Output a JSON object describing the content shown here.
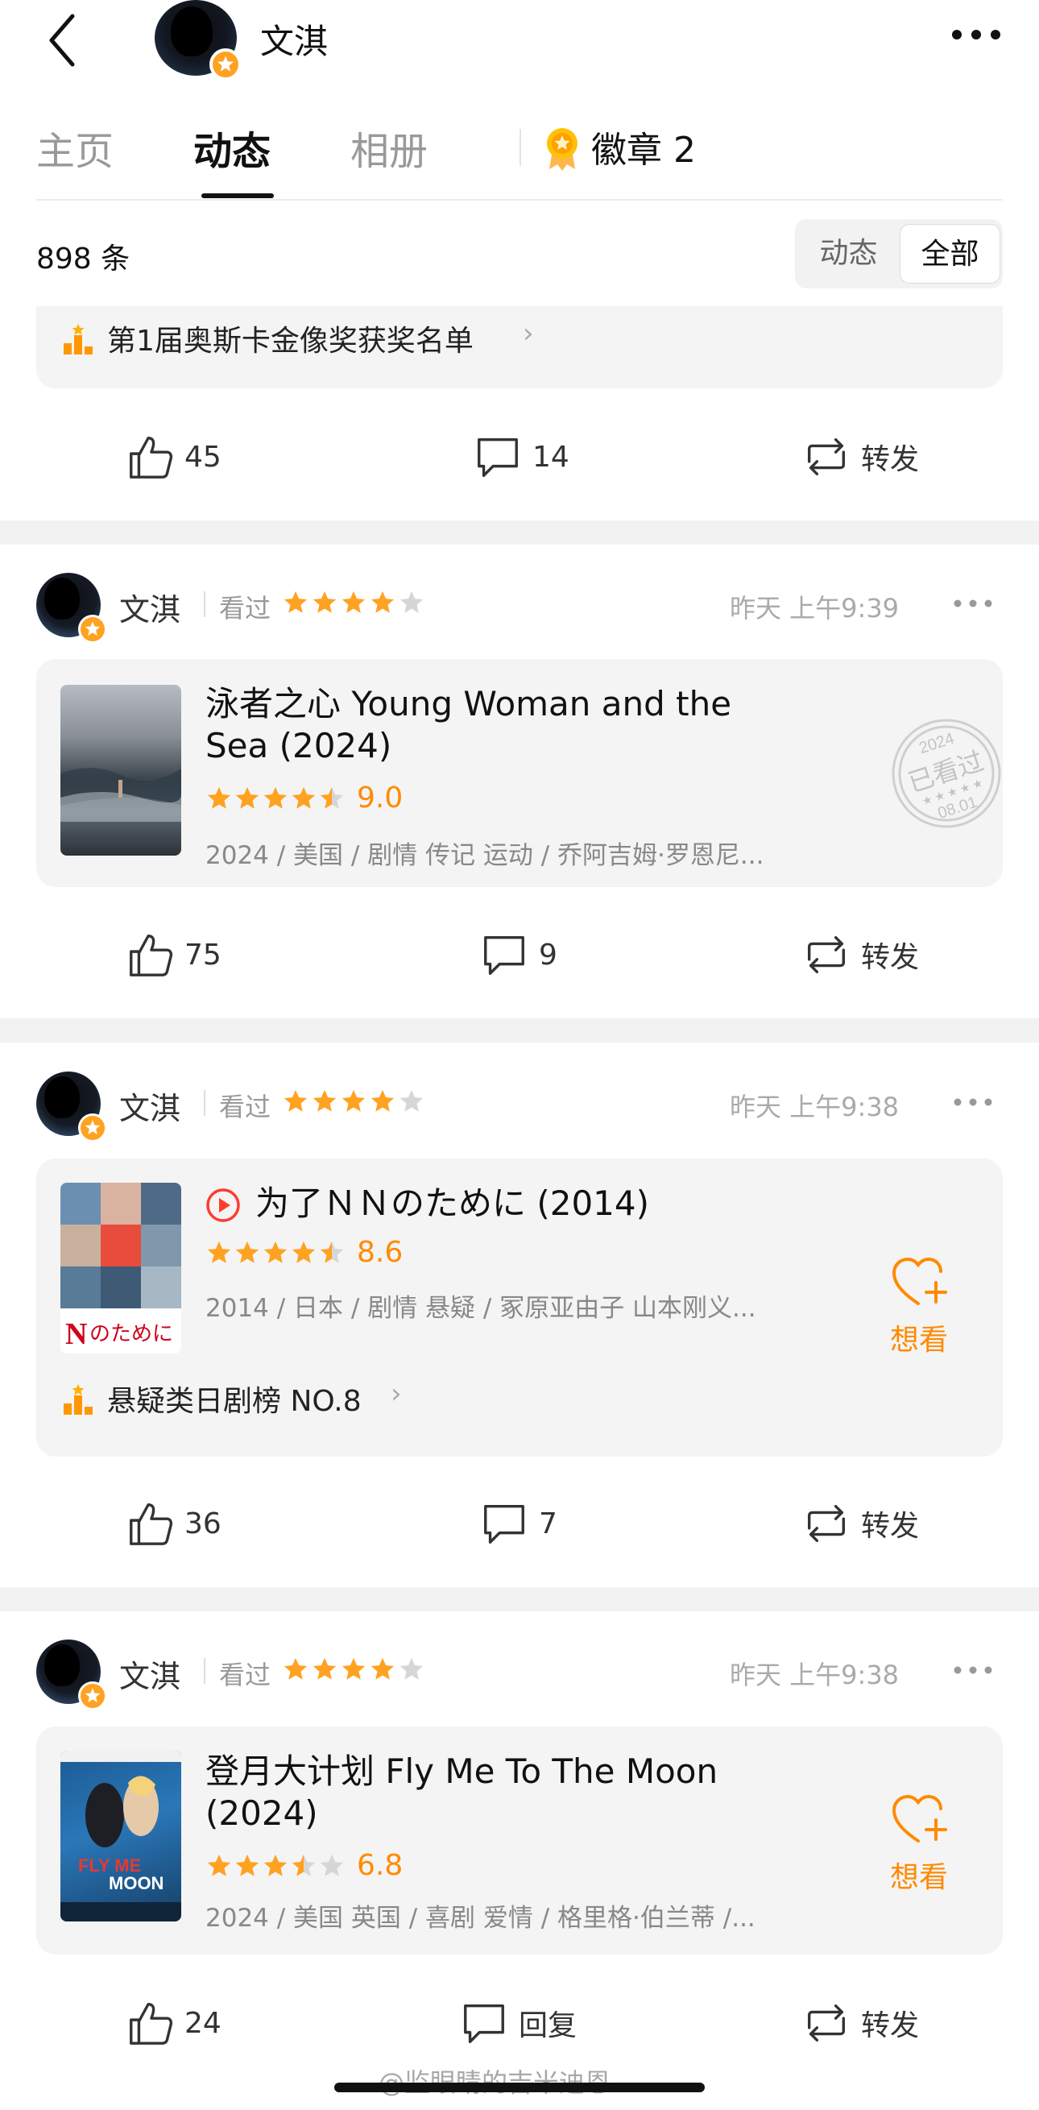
{
  "header": {
    "name": "文淇"
  },
  "tabs": [
    {
      "label": "主页"
    },
    {
      "label": "动态"
    },
    {
      "label": "相册"
    }
  ],
  "badge_tab": {
    "label": "徽章 2"
  },
  "feed": {
    "count": "898 条",
    "filter": {
      "options": [
        "动态",
        "全部"
      ],
      "selected": "全部"
    }
  },
  "posts": [
    {
      "rank_label": "第1届奥斯卡金像奖获奖名单",
      "likes": "45",
      "comments": "14",
      "repost": "转发"
    },
    {
      "author": "文淇",
      "status": "看过",
      "user_stars": 4,
      "time": "昨天 上午9:39",
      "movie": {
        "title_line1": "泳者之心 Young Woman and the",
        "title_line2": "Sea (2024)",
        "rating": "9.0",
        "rating_stars": 4.5,
        "meta": "2024 / 美国 / 剧情 传记 运动 / 乔阿吉姆·罗恩尼..."
      },
      "stamp": {
        "year": "2024",
        "text": "已看过",
        "date": "08.01"
      },
      "likes": "75",
      "comments": "9",
      "repost": "转发"
    },
    {
      "author": "文淇",
      "status": "看过",
      "user_stars": 4,
      "time": "昨天 上午9:38",
      "movie": {
        "title_line1": "为了ＮＮのために (2014)",
        "rating": "8.6",
        "rating_stars": 4.5,
        "meta": "2014 / 日本 / 剧情 悬疑 / 冢原亚由子 山本刚义..."
      },
      "want": "想看",
      "rank_label": "悬疑类日剧榜 NO.8",
      "likes": "36",
      "comments": "7",
      "repost": "转发"
    },
    {
      "author": "文淇",
      "status": "看过",
      "user_stars": 4,
      "time": "昨天 上午9:38",
      "movie": {
        "title_line1": "登月大计划 Fly Me To The Moon",
        "title_line2": "(2024)",
        "rating": "6.8",
        "rating_stars": 3.5,
        "meta": "2024 / 美国 英国 / 喜剧 爱情 / 格里格·伯兰蒂 /..."
      },
      "want": "想看",
      "likes": "24",
      "comments": "回复",
      "repost": "转发"
    }
  ],
  "watermark": "@监眼睛的吉米迪恩",
  "colors": {
    "accent": "#ff8a00",
    "star": "#ffa221",
    "card": "#f4f4f4",
    "separator": "#f2f2f2"
  }
}
